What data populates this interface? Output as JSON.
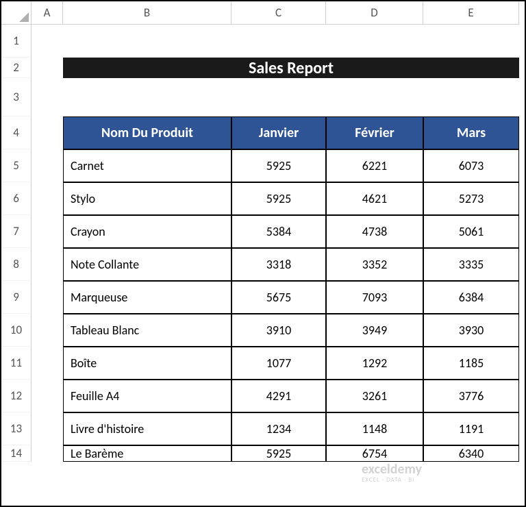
{
  "columns": [
    "A",
    "B",
    "C",
    "D",
    "E"
  ],
  "rows": [
    "1",
    "2",
    "3",
    "4",
    "5",
    "6",
    "7",
    "8",
    "9",
    "10",
    "11",
    "12",
    "13",
    "14"
  ],
  "title": "Sales Report",
  "headers": {
    "product": "Nom Du Produit",
    "month1": "Janvier",
    "month2": "Février",
    "month3": "Mars"
  },
  "data": [
    {
      "product": "Carnet",
      "m1": "5925",
      "m2": "6221",
      "m3": "6073"
    },
    {
      "product": "Stylo",
      "m1": "5925",
      "m2": "4621",
      "m3": "5273"
    },
    {
      "product": "Crayon",
      "m1": "5384",
      "m2": "4738",
      "m3": "5061"
    },
    {
      "product": "Note Collante",
      "m1": "3318",
      "m2": "3352",
      "m3": "3335"
    },
    {
      "product": "Marqueuse",
      "m1": "5675",
      "m2": "7093",
      "m3": "6384"
    },
    {
      "product": "Tableau Blanc",
      "m1": "3910",
      "m2": "3949",
      "m3": "3930"
    },
    {
      "product": "Boîte",
      "m1": "1077",
      "m2": "1292",
      "m3": "1185"
    },
    {
      "product": "Feuille A4",
      "m1": "4291",
      "m2": "3261",
      "m3": "3776"
    },
    {
      "product": "Livre d'histoire",
      "m1": "1234",
      "m2": "1148",
      "m3": "1191"
    },
    {
      "product": "Le Barème",
      "m1": "5925",
      "m2": "6754",
      "m3": "6340"
    }
  ],
  "watermark": {
    "brand": "exceldemy",
    "sub": "EXCEL · DATA · BI"
  }
}
